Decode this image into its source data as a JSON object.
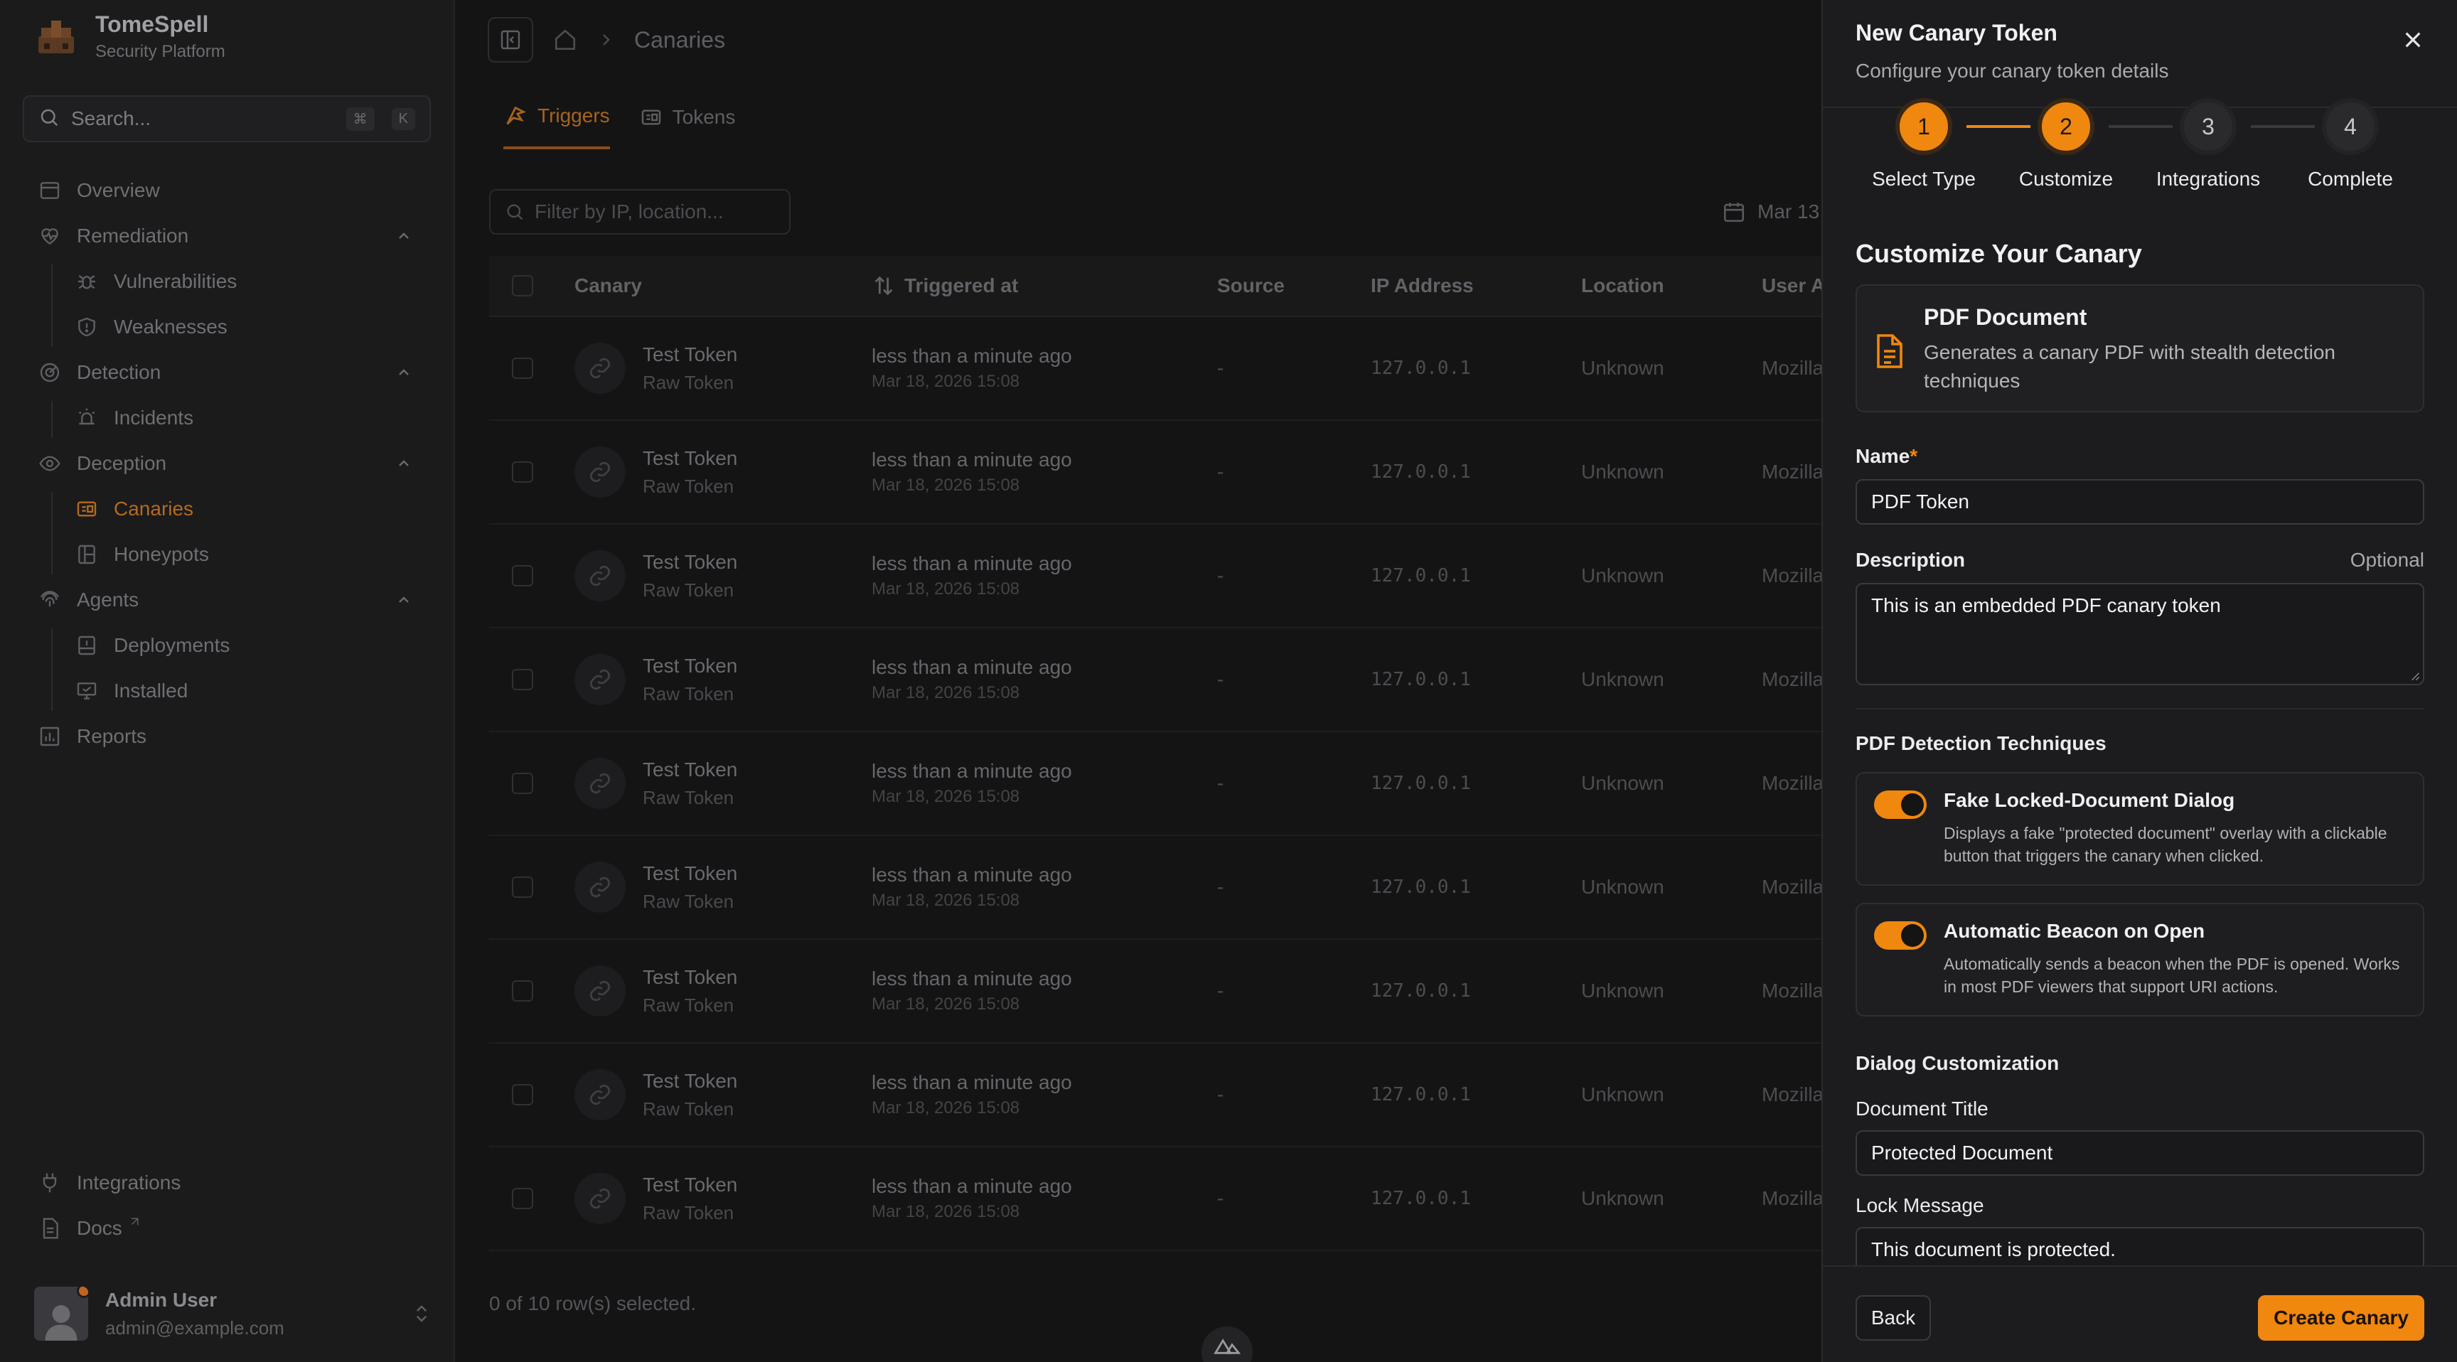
{
  "sidebar": {
    "brand_name": "TomeSpell",
    "brand_sub": "Security Platform",
    "search_placeholder": "Search...",
    "search_kbd_1": "⌘",
    "search_kbd_2": "K",
    "items": [
      {
        "label": "Overview",
        "icon": "overview-icon"
      },
      {
        "label": "Remediation",
        "icon": "heart-pulse-icon"
      },
      {
        "label": "Vulnerabilities",
        "icon": "bug-icon"
      },
      {
        "label": "Weaknesses",
        "icon": "shield-alert-icon"
      },
      {
        "label": "Detection",
        "icon": "radar-icon"
      },
      {
        "label": "Incidents",
        "icon": "siren-icon"
      },
      {
        "label": "Deception",
        "icon": "eye-icon"
      },
      {
        "label": "Canaries",
        "icon": "canary-icon"
      },
      {
        "label": "Honeypots",
        "icon": "honeypot-icon"
      },
      {
        "label": "Agents",
        "icon": "fingerprint-icon"
      },
      {
        "label": "Deployments",
        "icon": "deploy-icon"
      },
      {
        "label": "Installed",
        "icon": "monitor-icon"
      },
      {
        "label": "Reports",
        "icon": "chart-icon"
      }
    ],
    "bottom_items": [
      {
        "label": "Integrations",
        "icon": "plug-icon"
      },
      {
        "label": "Docs",
        "icon": "doc-icon"
      }
    ],
    "user": {
      "name": "Admin User",
      "email": "admin@example.com"
    }
  },
  "main": {
    "breadcrumb": "Canaries",
    "tabs": [
      {
        "label": "Triggers"
      },
      {
        "label": "Tokens"
      }
    ],
    "filter_placeholder": "Filter by IP, location...",
    "date_label": "Mar 13",
    "columns": [
      "Canary",
      "Triggered at",
      "Source",
      "IP Address",
      "Location",
      "User A"
    ],
    "rows": [
      {
        "name": "Test Token",
        "type": "Raw Token",
        "time": "less than a minute ago",
        "date": "Mar 18, 2026 15:08",
        "source": "-",
        "ip": "127.0.0.1",
        "location": "Unknown",
        "agent": "Mozilla"
      },
      {
        "name": "Test Token",
        "type": "Raw Token",
        "time": "less than a minute ago",
        "date": "Mar 18, 2026 15:08",
        "source": "-",
        "ip": "127.0.0.1",
        "location": "Unknown",
        "agent": "Mozilla"
      },
      {
        "name": "Test Token",
        "type": "Raw Token",
        "time": "less than a minute ago",
        "date": "Mar 18, 2026 15:08",
        "source": "-",
        "ip": "127.0.0.1",
        "location": "Unknown",
        "agent": "Mozilla"
      },
      {
        "name": "Test Token",
        "type": "Raw Token",
        "time": "less than a minute ago",
        "date": "Mar 18, 2026 15:08",
        "source": "-",
        "ip": "127.0.0.1",
        "location": "Unknown",
        "agent": "Mozilla"
      },
      {
        "name": "Test Token",
        "type": "Raw Token",
        "time": "less than a minute ago",
        "date": "Mar 18, 2026 15:08",
        "source": "-",
        "ip": "127.0.0.1",
        "location": "Unknown",
        "agent": "Mozilla"
      },
      {
        "name": "Test Token",
        "type": "Raw Token",
        "time": "less than a minute ago",
        "date": "Mar 18, 2026 15:08",
        "source": "-",
        "ip": "127.0.0.1",
        "location": "Unknown",
        "agent": "Mozilla"
      },
      {
        "name": "Test Token",
        "type": "Raw Token",
        "time": "less than a minute ago",
        "date": "Mar 18, 2026 15:08",
        "source": "-",
        "ip": "127.0.0.1",
        "location": "Unknown",
        "agent": "Mozilla"
      },
      {
        "name": "Test Token",
        "type": "Raw Token",
        "time": "less than a minute ago",
        "date": "Mar 18, 2026 15:08",
        "source": "-",
        "ip": "127.0.0.1",
        "location": "Unknown",
        "agent": "Mozilla"
      },
      {
        "name": "Test Token",
        "type": "Raw Token",
        "time": "less than a minute ago",
        "date": "Mar 18, 2026 15:08",
        "source": "-",
        "ip": "127.0.0.1",
        "location": "Unknown",
        "agent": "Mozilla"
      }
    ],
    "selection_note": "0 of 10 row(s) selected."
  },
  "drawer": {
    "title": "New Canary Token",
    "subtitle": "Configure your canary token details",
    "steps": [
      {
        "num": "1",
        "label": "Select Type",
        "done": true
      },
      {
        "num": "2",
        "label": "Customize",
        "done": true
      },
      {
        "num": "3",
        "label": "Integrations",
        "done": false
      },
      {
        "num": "4",
        "label": "Complete",
        "done": false
      }
    ],
    "section_title": "Customize Your Canary",
    "type_card": {
      "title": "PDF Document",
      "description": "Generates a canary PDF with stealth detection techniques"
    },
    "name_label": "Name",
    "name_required": "*",
    "name_value": "PDF Token",
    "description_label": "Description",
    "description_optional": "Optional",
    "description_value": "This is an embedded PDF canary token",
    "techniques_title": "PDF Detection Techniques",
    "techniques": [
      {
        "title": "Fake Locked-Document Dialog",
        "description": "Displays a fake \"protected document\" overlay with a clickable button that triggers the canary when clicked.",
        "enabled": true
      },
      {
        "title": "Automatic Beacon on Open",
        "description": "Automatically sends a beacon when the PDF is opened. Works in most PDF viewers that support URI actions.",
        "enabled": true
      }
    ],
    "dialog_title": "Dialog Customization",
    "doc_title_label": "Document Title",
    "doc_title_value": "Protected Document",
    "lock_label": "Lock Message",
    "lock_value": "This document is protected.",
    "back_label": "Back",
    "create_label": "Create Canary"
  },
  "colors": {
    "accent": "#f0870f",
    "background": "#151516",
    "panel": "#1c1c1e"
  }
}
